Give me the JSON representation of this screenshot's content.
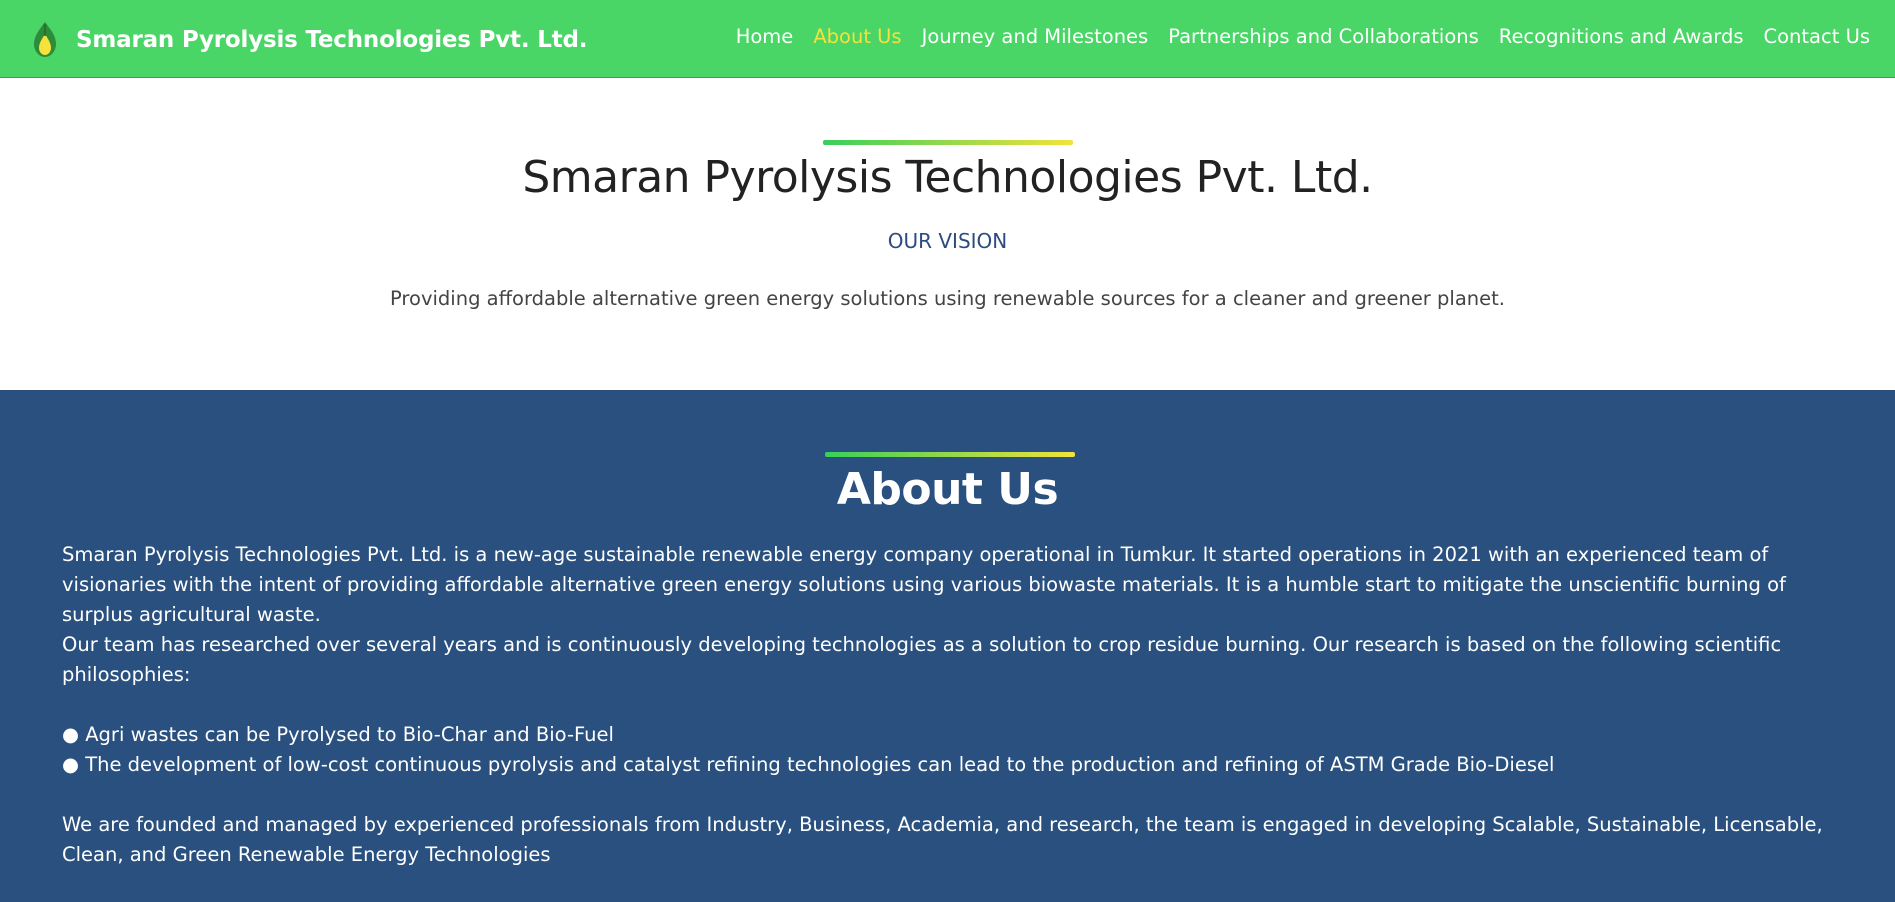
{
  "brand": {
    "name": "Smaran Pyrolysis Technologies Pvt. Ltd.",
    "icon": "droplet-leaf-logo-icon"
  },
  "nav": {
    "items": [
      {
        "label": "Home",
        "active": false
      },
      {
        "label": "About Us",
        "active": true
      },
      {
        "label": "Journey and Milestones",
        "active": false
      },
      {
        "label": "Partnerships and Collaborations",
        "active": false
      },
      {
        "label": "Recognitions and Awards",
        "active": false
      },
      {
        "label": "Contact Us",
        "active": false
      }
    ]
  },
  "vision": {
    "title": "Smaran Pyrolysis Technologies Pvt. Ltd.",
    "subtitle": "OUR VISION",
    "text": "Providing affordable alternative green energy solutions using renewable sources for a cleaner and greener planet."
  },
  "about": {
    "title": "About Us",
    "paragraph1": "Smaran Pyrolysis Technologies Pvt. Ltd. is a new-age sustainable renewable energy company operational in Tumkur. It started operations in 2021 with an experienced team of visionaries with the intent of providing affordable alternative green energy solutions using various biowaste materials. It is a humble start to mitigate the unscientific burning of surplus agricultural waste.",
    "paragraph2": "Our team has researched over several years and is continuously developing technologies as a solution to crop residue burning. Our research is based on the following scientific philosophies:",
    "bullets": [
      "● Agri wastes can be Pyrolysed to Bio-Char and Bio-Fuel",
      "● The development of low-cost continuous pyrolysis and catalyst refining technologies can lead to the production and refining of ASTM Grade Bio-Diesel"
    ],
    "paragraph3": "We are founded and managed by experienced professionals from Industry, Business, Academia, and research, the team is engaged in developing Scalable, Sustainable, Licensable, Clean, and Green Renewable Energy Technologies"
  },
  "colors": {
    "navbar": "#4ad567",
    "active_link": "#f3e23b",
    "about_bg": "#29507e",
    "accent_gradient_start": "#38cf5c",
    "accent_gradient_end": "#f3e23b"
  }
}
